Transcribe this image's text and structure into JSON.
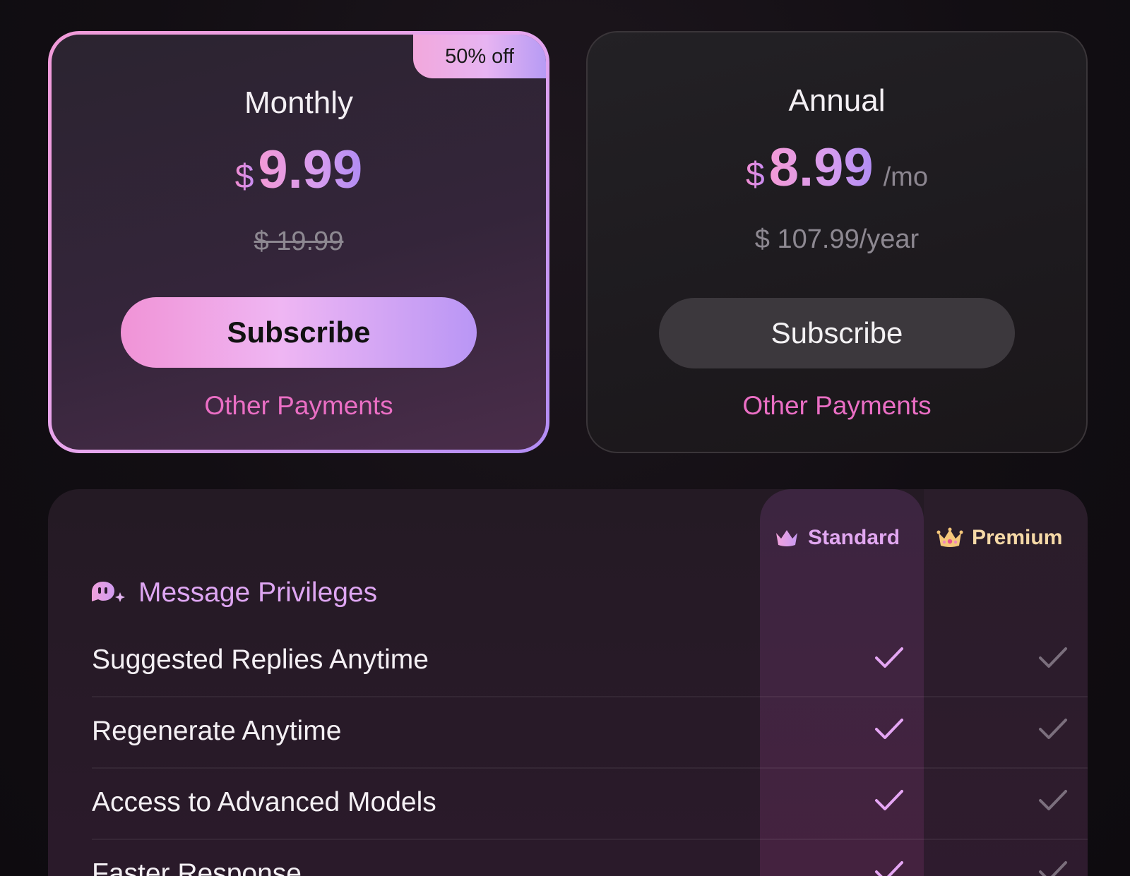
{
  "plans": {
    "monthly": {
      "badge": "50% off",
      "title": "Monthly",
      "currency": "$",
      "amount": "9.99",
      "original_price": "$ 19.99",
      "subscribe_label": "Subscribe",
      "other_payments_label": "Other Payments"
    },
    "annual": {
      "title": "Annual",
      "currency": "$",
      "amount": "8.99",
      "per_unit": "/mo",
      "yearly_price": "$ 107.99/year",
      "subscribe_label": "Subscribe",
      "other_payments_label": "Other Payments"
    }
  },
  "features": {
    "columns": {
      "standard": {
        "label": "Standard",
        "icon": "crown-icon",
        "color": "#e1a7f0"
      },
      "premium": {
        "label": "Premium",
        "icon": "jeweled-crown-icon",
        "color": "#f6d9a7"
      }
    },
    "section": {
      "title": "Message Privileges",
      "icon": "chat-bubble-sparkle-icon"
    },
    "rows": [
      {
        "label": "Suggested Replies Anytime",
        "standard": true,
        "premium": true
      },
      {
        "label": "Regenerate Anytime",
        "standard": true,
        "premium": true
      },
      {
        "label": "Access to Advanced Models",
        "standard": true,
        "premium": true
      },
      {
        "label": "Faster Response",
        "standard": true,
        "premium": true
      }
    ]
  },
  "colors": {
    "accent_pink": "#ea6ec4",
    "accent_gradient_start": "#f093d6",
    "accent_gradient_end": "#b996f5"
  }
}
